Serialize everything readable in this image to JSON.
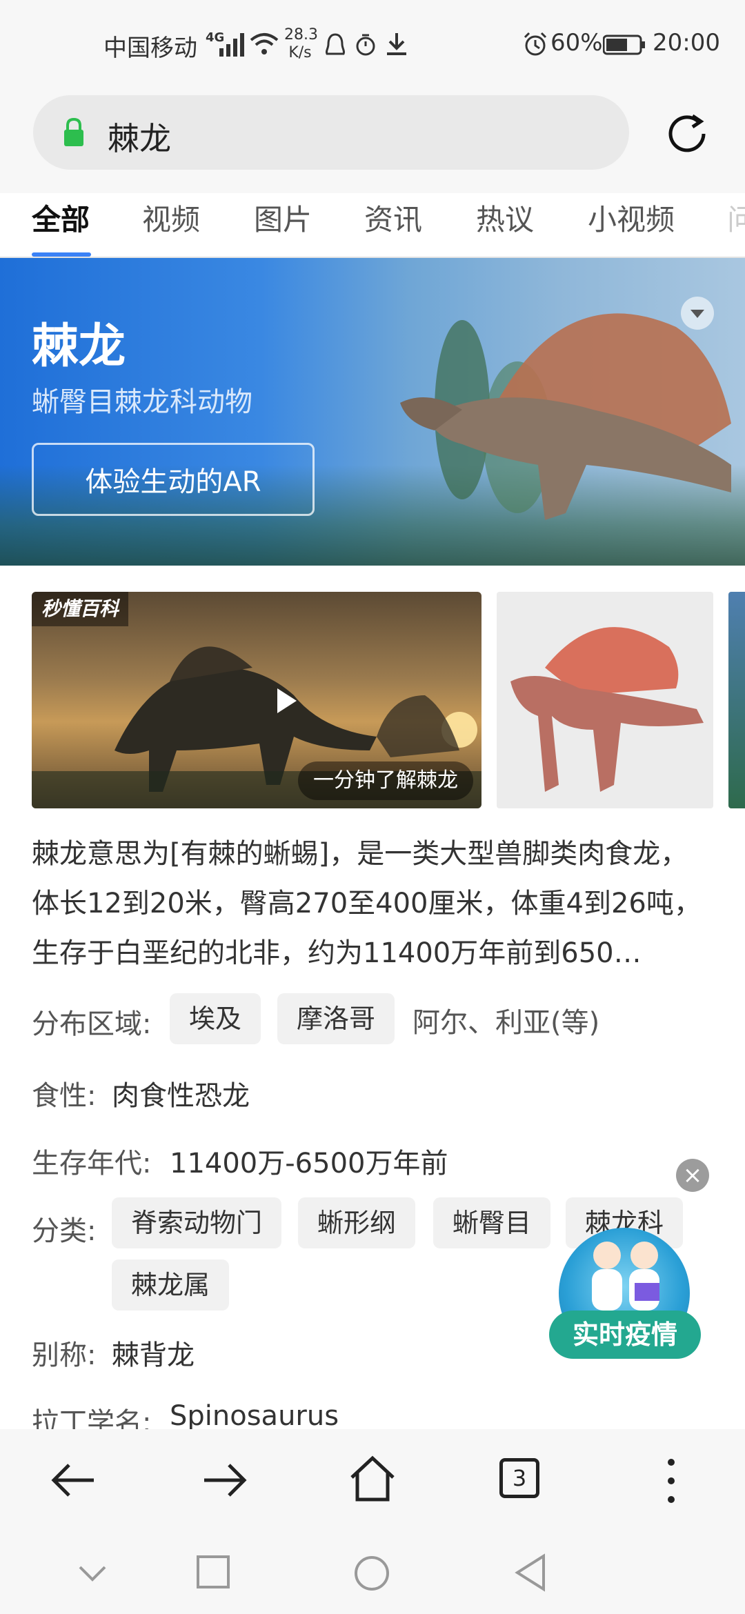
{
  "status_bar": {
    "carrier": "中国移动",
    "network": "4G",
    "speed_value": "28.3",
    "speed_unit": "K/s",
    "battery": "60%",
    "time": "20:00"
  },
  "search": {
    "query": "棘龙"
  },
  "tabs": [
    {
      "label": "全部",
      "active": true
    },
    {
      "label": "视频"
    },
    {
      "label": "图片"
    },
    {
      "label": "资讯"
    },
    {
      "label": "热议"
    },
    {
      "label": "小视频"
    },
    {
      "label": "问"
    }
  ],
  "hero": {
    "title": "棘龙",
    "subtitle": "蜥臀目棘龙科动物",
    "ar_button": "体验生动的AR"
  },
  "media": {
    "video_brand": "秒懂百科",
    "video_caption": "一分钟了解棘龙"
  },
  "description": "棘龙意思为[有棘的蜥蜴]，是一类大型兽脚类肉食龙，体长12到20米，臀高270至400厘米，体重4到26吨，生存于白垩纪的北非，约为11400万年前到650…",
  "info": {
    "distribution_label": "分布区域:",
    "distribution_chips": [
      "埃及",
      "摩洛哥"
    ],
    "distribution_more": "阿尔、利亚(等)",
    "diet_label": "食性:",
    "diet_value": "肉食性恐龙",
    "era_label": "生存年代:",
    "era_value": "11400万-6500万年前",
    "classification_label": "分类:",
    "classification_chips": [
      "脊索动物门",
      "蜥形纲",
      "蜥臀目",
      "棘龙科",
      "棘龙属"
    ],
    "alias_label": "别称:",
    "alias_value": "棘背龙",
    "latin_label": "拉丁学名:",
    "latin_value": "Spinosaurus"
  },
  "floating_widget": {
    "label": "实时疫情"
  },
  "toolbar": {
    "tabs_count": "3"
  },
  "colors": {
    "accent": "#3b82f6",
    "lock_green": "#2dbe4e",
    "widget_teal": "#23a890"
  }
}
